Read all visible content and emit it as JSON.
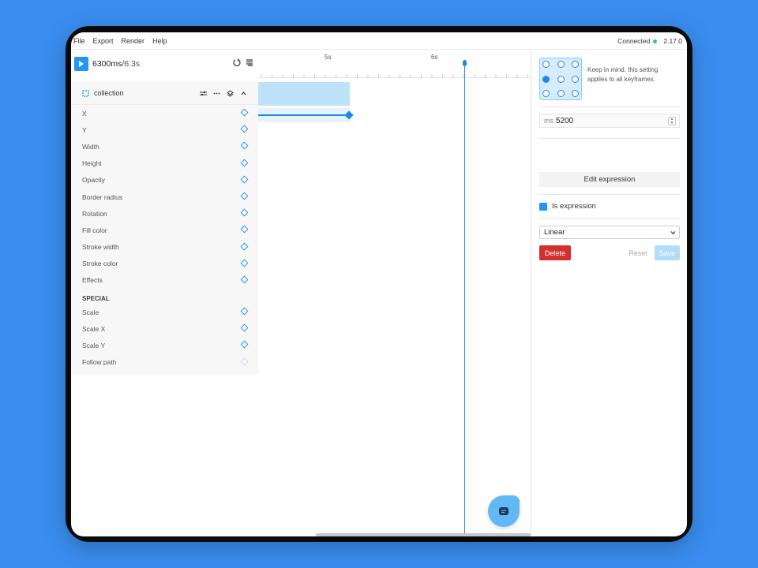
{
  "menu": {
    "items": [
      "File",
      "Export",
      "Render",
      "Help"
    ]
  },
  "status": {
    "connection": "Connected",
    "version": "2.17.0",
    "connected_color": "#2ecc71"
  },
  "playback": {
    "current": "6300ms",
    "total": "/6.3s"
  },
  "ruler": {
    "labels": [
      "5s",
      "6s"
    ]
  },
  "layer": {
    "name": "collection"
  },
  "properties": [
    {
      "label": "X",
      "active": true
    },
    {
      "label": "Y",
      "active": true
    },
    {
      "label": "Width",
      "active": true
    },
    {
      "label": "Height",
      "active": true
    },
    {
      "label": "Opacity",
      "active": true
    },
    {
      "label": "Border radius",
      "active": true
    },
    {
      "label": "Rotation",
      "active": true
    },
    {
      "label": "Fill color",
      "active": true
    },
    {
      "label": "Stroke width",
      "active": true
    },
    {
      "label": "Stroke color",
      "active": true
    },
    {
      "label": "Effects",
      "active": true
    }
  ],
  "special": {
    "heading": "SPECIAL",
    "properties": [
      {
        "label": "Scale",
        "active": true
      },
      {
        "label": "Scale X",
        "active": true
      },
      {
        "label": "Scale Y",
        "active": true
      },
      {
        "label": "Follow path",
        "active": false
      }
    ]
  },
  "inspector": {
    "origin_selected": "middle-left",
    "info": "Keep in mind, this setting applies to all keyframes.",
    "ms_unit": "ms",
    "ms_value": "5200",
    "edit_expression": "Edit expression",
    "is_expression": "Is expression",
    "easing": "Linear",
    "delete": "Delete",
    "reset": "Reset",
    "save": "Save"
  },
  "colors": {
    "accent": "#2196f3",
    "danger": "#d32f2f",
    "background": "#3a8ef0"
  }
}
